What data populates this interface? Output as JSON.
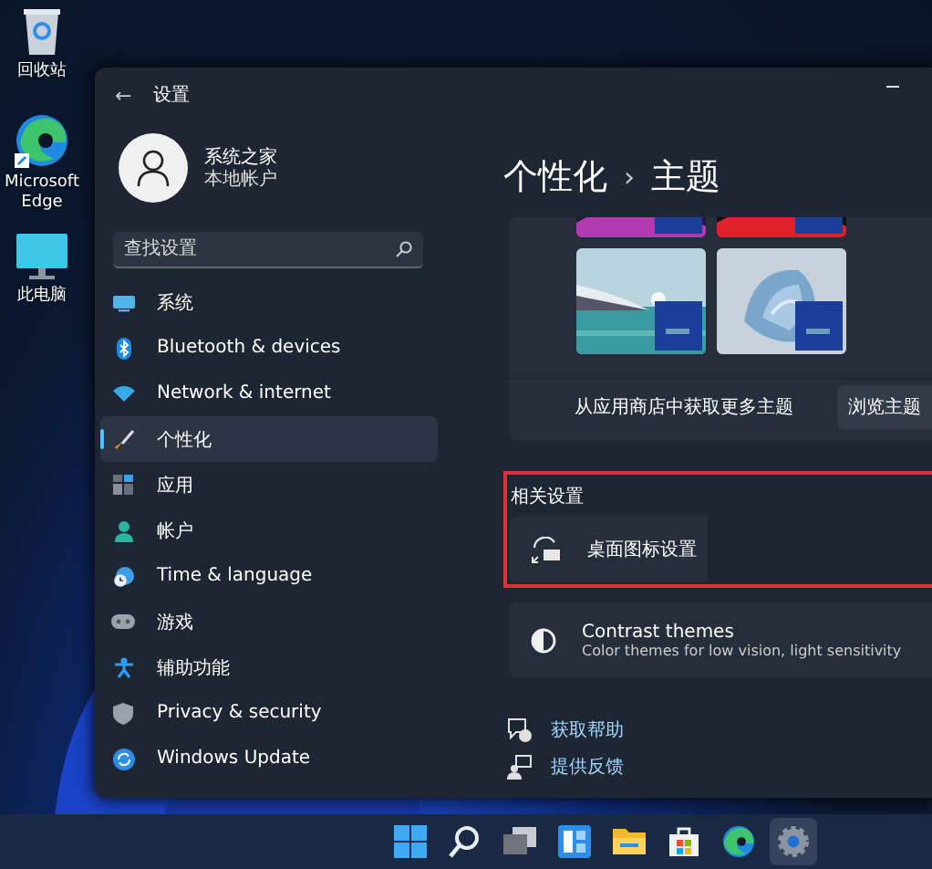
{
  "desktop_icons": [
    {
      "kind": "recycle",
      "label": "回收站"
    },
    {
      "kind": "edge",
      "label": "Microsoft Edge"
    },
    {
      "kind": "pc",
      "label": "此电脑"
    }
  ],
  "window": {
    "title": "设置",
    "back": "←"
  },
  "profile": {
    "name": "系统之家",
    "subtitle": "本地帐户"
  },
  "search": {
    "placeholder": "查找设置"
  },
  "nav": [
    {
      "kind": "system",
      "label": "系统",
      "selected": false
    },
    {
      "kind": "bluetooth",
      "label": "Bluetooth & devices",
      "selected": false
    },
    {
      "kind": "network",
      "label": "Network & internet",
      "selected": false
    },
    {
      "kind": "brush",
      "label": "个性化",
      "selected": true
    },
    {
      "kind": "apps",
      "label": "应用",
      "selected": false
    },
    {
      "kind": "account",
      "label": "帐户",
      "selected": false
    },
    {
      "kind": "time",
      "label": "Time & language",
      "selected": false
    },
    {
      "kind": "gaming",
      "label": "游戏",
      "selected": false
    },
    {
      "kind": "access",
      "label": "辅助功能",
      "selected": false
    },
    {
      "kind": "privacy",
      "label": "Privacy & security",
      "selected": false
    },
    {
      "kind": "update",
      "label": "Windows Update",
      "selected": false
    }
  ],
  "breadcrumb": {
    "parent": "个性化",
    "separator": "›",
    "current": "主题"
  },
  "themes": {
    "store_text": "从应用商店中获取更多主题",
    "browse_button": "浏览主题"
  },
  "related": {
    "title": "相关设置",
    "items": [
      {
        "kind": "desktop-icons",
        "title": "桌面图标设置",
        "highlighted": true
      },
      {
        "kind": "contrast",
        "title": "Contrast themes",
        "description": "Color themes for low vision, light sensitivity",
        "highlighted": false
      }
    ]
  },
  "links": [
    {
      "kind": "help",
      "label": "获取帮助"
    },
    {
      "kind": "feedback",
      "label": "提供反馈"
    }
  ],
  "taskbar": [
    {
      "kind": "start",
      "selected": false
    },
    {
      "kind": "search",
      "selected": false
    },
    {
      "kind": "taskview",
      "selected": false
    },
    {
      "kind": "widgets",
      "selected": false
    },
    {
      "kind": "explorer",
      "selected": false
    },
    {
      "kind": "store",
      "selected": false
    },
    {
      "kind": "edge",
      "selected": false
    },
    {
      "kind": "settings",
      "selected": true
    }
  ]
}
